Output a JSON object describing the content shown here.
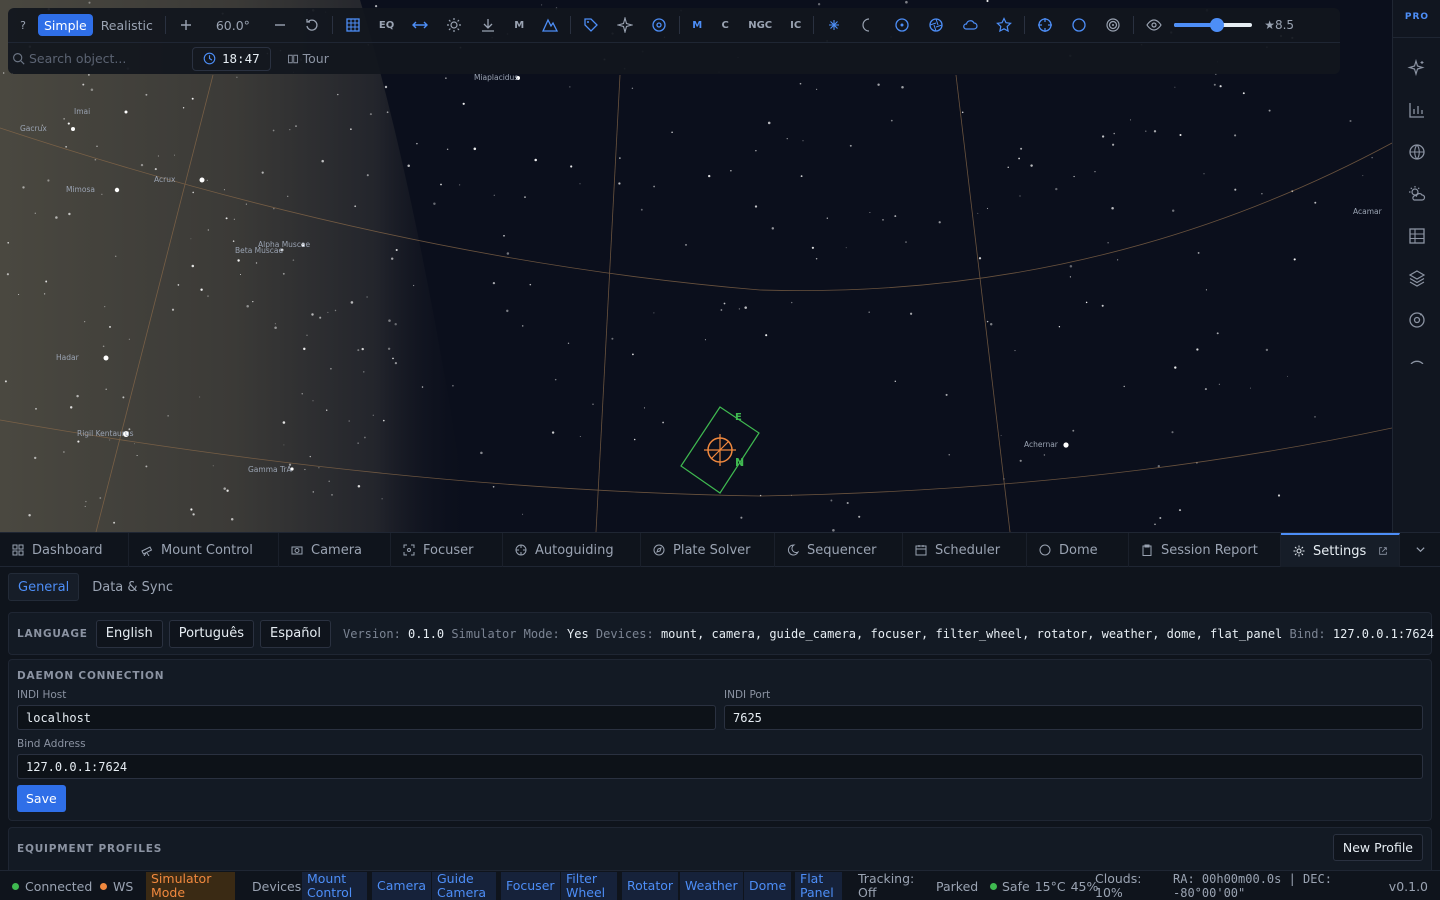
{
  "colors": {
    "accent": "#2f6fe8",
    "accent_text": "#4d8ef7",
    "connected": "#3fb950",
    "ws": "#f0883e",
    "sim": "#f0883e",
    "fov": "#3fb950",
    "target": "#f0883e"
  },
  "toolbar": {
    "help": "?",
    "mode_simple": "Simple",
    "mode_realistic": "Realistic",
    "fov": "60.0°",
    "eq": "EQ",
    "m_label": "M",
    "catalog_m": "M",
    "catalog_c": "C",
    "catalog_ngc": "NGC",
    "catalog_ic": "IC",
    "search_placeholder": "Search object...",
    "time": "18:47",
    "tour": "Tour",
    "magnitude_fraction": 0.55,
    "magnitude": "★8.5"
  },
  "sidebar": {
    "badge": "PRO"
  },
  "sky": {
    "labels": [
      {
        "name": "Miaplacidus"
      },
      {
        "name": "Imai"
      },
      {
        "name": "Gacrux"
      },
      {
        "name": "Acrux"
      },
      {
        "name": "Mimosa"
      },
      {
        "name": "Alpha Muscae"
      },
      {
        "name": "Beta Muscae"
      },
      {
        "name": "Hadar"
      },
      {
        "name": "Rigil Kentaurus"
      },
      {
        "name": "Gamma TrA"
      },
      {
        "name": "Achernar"
      },
      {
        "name": "Acamar"
      }
    ],
    "fov_east": "E",
    "fov_north": "N"
  },
  "tabs": [
    {
      "label": "Dashboard",
      "icon": "grid-icon"
    },
    {
      "label": "Mount Control",
      "icon": "telescope-icon"
    },
    {
      "label": "Camera",
      "icon": "camera-icon"
    },
    {
      "label": "Focuser",
      "icon": "focus-icon"
    },
    {
      "label": "Autoguiding",
      "icon": "crosshair-icon"
    },
    {
      "label": "Plate Solver",
      "icon": "compass-icon"
    },
    {
      "label": "Sequencer",
      "icon": "moon-icon"
    },
    {
      "label": "Scheduler",
      "icon": "calendar-icon"
    },
    {
      "label": "Dome",
      "icon": "circle-icon"
    },
    {
      "label": "Session Report",
      "icon": "clipboard-icon"
    },
    {
      "label": "Settings",
      "icon": "gear-icon"
    }
  ],
  "settings": {
    "subtabs": [
      "General",
      "Data & Sync"
    ],
    "language": {
      "title": "LANGUAGE",
      "options": [
        "English",
        "Português",
        "Español"
      ]
    },
    "info": {
      "version_key": "Version:",
      "version_val": "0.1.0",
      "sim_key": "Simulator Mode:",
      "sim_val": "Yes",
      "devices_key": "Devices:",
      "devices_val": "mount, camera, guide_camera, focuser, filter_wheel, rotator, weather, dome, flat_panel",
      "bind_key": "Bind:",
      "bind_val": "127.0.0.1:7624"
    },
    "daemon": {
      "title": "DAEMON CONNECTION",
      "host_label": "INDI Host",
      "host_value": "localhost",
      "port_label": "INDI Port",
      "port_value": "7625",
      "bind_label": "Bind Address",
      "bind_value": "127.0.0.1:7624",
      "save": "Save"
    },
    "profiles": {
      "title": "EQUIPMENT PROFILES",
      "new_profile": "New Profile"
    }
  },
  "status": {
    "connected": "Connected",
    "ws": "WS",
    "sim_line1": "Simulator",
    "sim_line2": "Mode",
    "devices_label": "Devices:",
    "devices": [
      [
        "Mount",
        "Control"
      ],
      [
        "Camera"
      ],
      [
        "Guide",
        "Camera"
      ],
      [
        "Focuser"
      ],
      [
        "Filter",
        "Wheel"
      ],
      [
        "Rotator"
      ],
      [
        "Weather"
      ],
      [
        "Dome"
      ],
      [
        "Flat",
        "Panel"
      ]
    ],
    "tracking_line1": "Tracking:",
    "tracking_line2": "Off",
    "parked": "Parked",
    "safe": "Safe",
    "temp": "15°C",
    "humidity": "45%",
    "clouds_line1": "Clouds:",
    "clouds_line2": "10%",
    "ra_line1": "RA: 00h00m00.0s | DEC:",
    "ra_line2": "-80°00'00\"",
    "version": "v0.1.0"
  }
}
